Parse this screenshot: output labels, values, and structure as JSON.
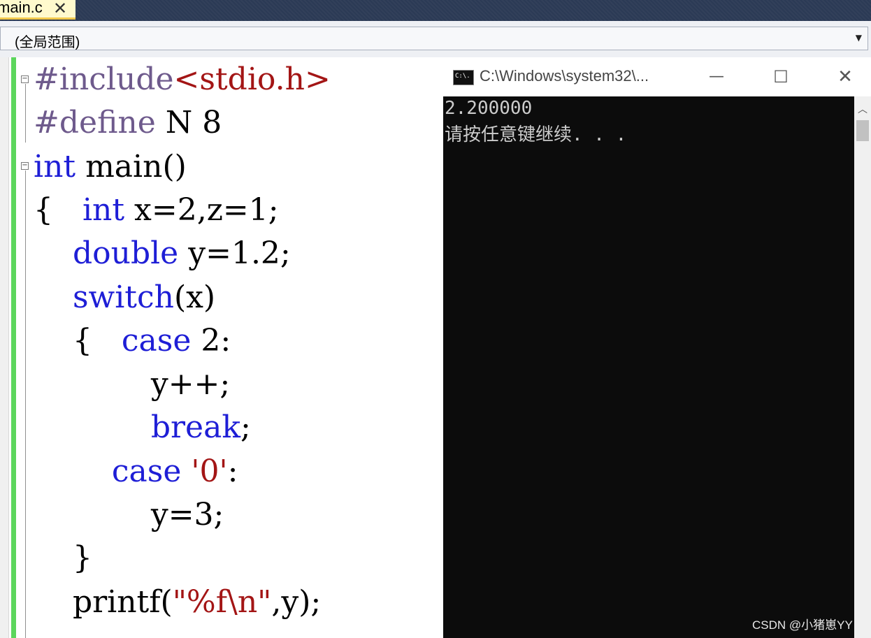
{
  "tab": {
    "file_name": "main.c",
    "close_glyph": "✕"
  },
  "scope": {
    "value": "(全局范围)"
  },
  "editor": {
    "lines": [
      {
        "parts": [
          {
            "t": "#include",
            "c": "pp"
          },
          {
            "t": "<stdio.h>",
            "c": "str"
          }
        ]
      },
      {
        "parts": [
          {
            "t": "#define",
            "c": "pp"
          },
          {
            "t": " N 8",
            "c": "plain"
          }
        ]
      },
      {
        "parts": [
          {
            "t": "int",
            "c": "kw"
          },
          {
            "t": " main()",
            "c": "plain"
          }
        ]
      },
      {
        "parts": [
          {
            "t": "{   ",
            "c": "plain"
          },
          {
            "t": "int",
            "c": "kw"
          },
          {
            "t": " x=2,z=1;",
            "c": "plain"
          }
        ]
      },
      {
        "parts": [
          {
            "t": "    ",
            "c": "plain"
          },
          {
            "t": "double",
            "c": "kw"
          },
          {
            "t": " y=1.2;",
            "c": "plain"
          }
        ]
      },
      {
        "parts": [
          {
            "t": "    ",
            "c": "plain"
          },
          {
            "t": "switch",
            "c": "kw"
          },
          {
            "t": "(x)",
            "c": "plain"
          }
        ]
      },
      {
        "parts": [
          {
            "t": "    {   ",
            "c": "plain"
          },
          {
            "t": "case",
            "c": "kw"
          },
          {
            "t": " 2:",
            "c": "plain"
          }
        ]
      },
      {
        "parts": [
          {
            "t": "            y++;",
            "c": "plain"
          }
        ]
      },
      {
        "parts": [
          {
            "t": "            ",
            "c": "plain"
          },
          {
            "t": "break",
            "c": "kw"
          },
          {
            "t": ";",
            "c": "plain"
          }
        ]
      },
      {
        "parts": [
          {
            "t": "        ",
            "c": "plain"
          },
          {
            "t": "case",
            "c": "kw"
          },
          {
            "t": " ",
            "c": "plain"
          },
          {
            "t": "'0'",
            "c": "str"
          },
          {
            "t": ":",
            "c": "plain"
          }
        ]
      },
      {
        "parts": [
          {
            "t": "            y=3;",
            "c": "plain"
          }
        ]
      },
      {
        "parts": [
          {
            "t": "    }",
            "c": "plain"
          }
        ]
      },
      {
        "parts": [
          {
            "t": "    printf(",
            "c": "plain"
          },
          {
            "t": "\"%f\\n\"",
            "c": "str"
          },
          {
            "t": ",y);",
            "c": "plain"
          }
        ]
      }
    ]
  },
  "console": {
    "title": "C:\\Windows\\system32\\...",
    "icon_text": "C:\\.",
    "minimize": "—",
    "maximize": "☐",
    "close": "✕",
    "output": [
      "2.200000",
      "请按任意键继续. . ."
    ]
  },
  "watermark": "CSDN @小猪崽YY",
  "colors": {
    "keyword": "#1e1ed6",
    "string": "#a31515",
    "preprocessor": "#6e5a8c",
    "change_bar": "#5cd65c",
    "console_bg": "#0c0c0c"
  }
}
